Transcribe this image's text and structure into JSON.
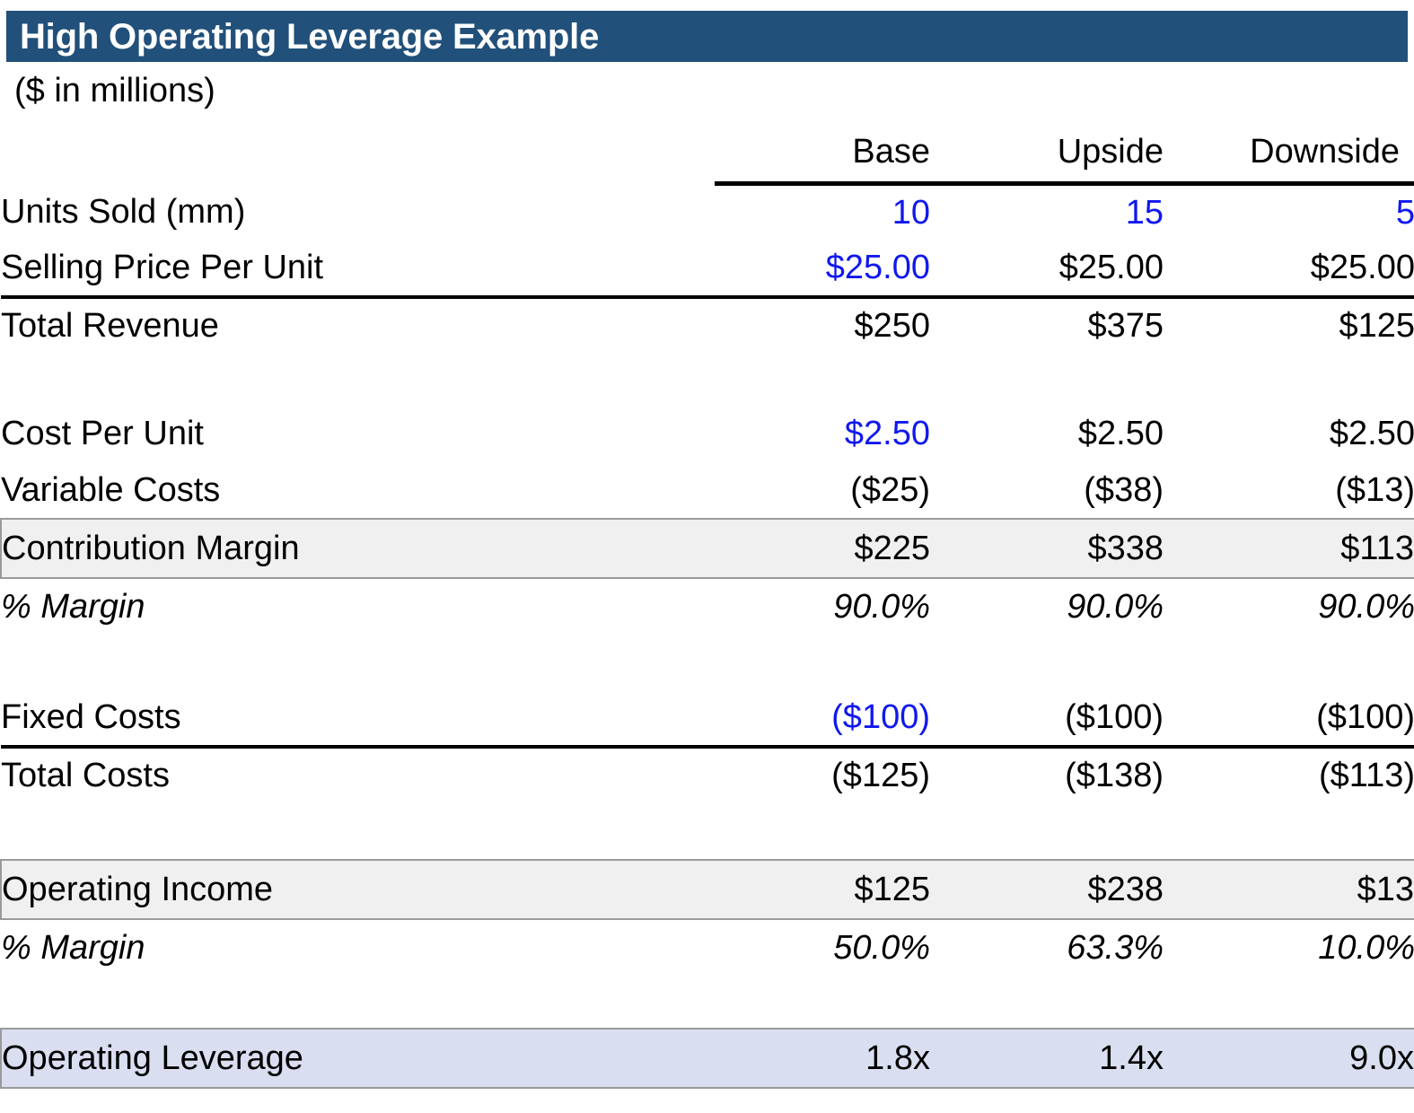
{
  "header": {
    "title": "High Operating Leverage Example",
    "units_note": "($ in millions)",
    "bar_color": "#21507A"
  },
  "colors": {
    "input_blue": "#1018EE",
    "subtotal_shade": "#F0F0F0",
    "result_shade": "#D9DEF0",
    "header_blue": "#21507A"
  },
  "columns": {
    "label": "",
    "base": "Base",
    "upside": "Upside",
    "downside": "Downside"
  },
  "rows": {
    "units_sold": {
      "label": "Units Sold (mm)",
      "base": "10",
      "upside": "15",
      "downside": "5"
    },
    "selling_price": {
      "label": "Selling Price Per Unit",
      "base": "$25.00",
      "upside": "$25.00",
      "downside": "$25.00"
    },
    "total_revenue": {
      "label": "Total Revenue",
      "base": "$250",
      "upside": "$375",
      "downside": "$125"
    },
    "cost_per_unit": {
      "label": "Cost Per Unit",
      "base": "$2.50",
      "upside": "$2.50",
      "downside": "$2.50"
    },
    "variable_costs": {
      "label": "Variable Costs",
      "base": "($25)",
      "upside": "($38)",
      "downside": "($13)"
    },
    "contribution_margin": {
      "label": "Contribution Margin",
      "base": "$225",
      "upside": "$338",
      "downside": "$113"
    },
    "cm_margin_pct": {
      "label": "% Margin",
      "base": "90.0%",
      "upside": "90.0%",
      "downside": "90.0%"
    },
    "fixed_costs": {
      "label": "Fixed Costs",
      "base": "($100)",
      "upside": "($100)",
      "downside": "($100)"
    },
    "total_costs": {
      "label": "Total Costs",
      "base": "($125)",
      "upside": "($138)",
      "downside": "($113)"
    },
    "operating_income": {
      "label": "Operating Income",
      "base": "$125",
      "upside": "$238",
      "downside": "$13"
    },
    "oi_margin_pct": {
      "label": "% Margin",
      "base": "50.0%",
      "upside": "63.3%",
      "downside": "10.0%"
    },
    "operating_leverage": {
      "label": "Operating Leverage",
      "base": "1.8x",
      "upside": "1.4x",
      "downside": "9.0x"
    }
  }
}
